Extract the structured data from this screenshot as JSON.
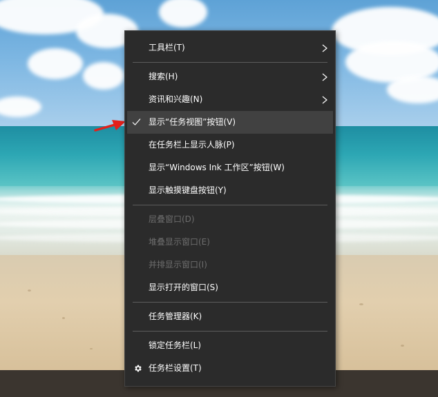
{
  "context_menu": {
    "items": [
      {
        "label": "工具栏(T)",
        "has_submenu": true,
        "enabled": true
      },
      {
        "label": "搜索(H)",
        "has_submenu": true,
        "enabled": true
      },
      {
        "label": "资讯和兴趣(N)",
        "has_submenu": true,
        "enabled": true
      },
      {
        "label": "显示“任务视图”按钮(V)",
        "checked": true,
        "highlighted": true,
        "enabled": true
      },
      {
        "label": "在任务栏上显示人脉(P)",
        "enabled": true
      },
      {
        "label": "显示“Windows Ink 工作区”按钮(W)",
        "enabled": true
      },
      {
        "label": "显示触摸键盘按钮(Y)",
        "enabled": true
      },
      {
        "label": "层叠窗口(D)",
        "enabled": false
      },
      {
        "label": "堆叠显示窗口(E)",
        "enabled": false
      },
      {
        "label": "并排显示窗口(I)",
        "enabled": false
      },
      {
        "label": "显示打开的窗口(S)",
        "enabled": true
      },
      {
        "label": "任务管理器(K)",
        "enabled": true
      },
      {
        "label": "锁定任务栏(L)",
        "enabled": true
      },
      {
        "label": "任务栏设置(T)",
        "icon": "gear-icon",
        "enabled": true
      }
    ]
  },
  "colors": {
    "menu_background": "#2b2b2b",
    "highlight": "#414141",
    "text": "#ffffff",
    "disabled_text": "#6d6d6d",
    "arrow": "#e3201b"
  },
  "annotation": {
    "icon": "red-arrow-icon"
  }
}
